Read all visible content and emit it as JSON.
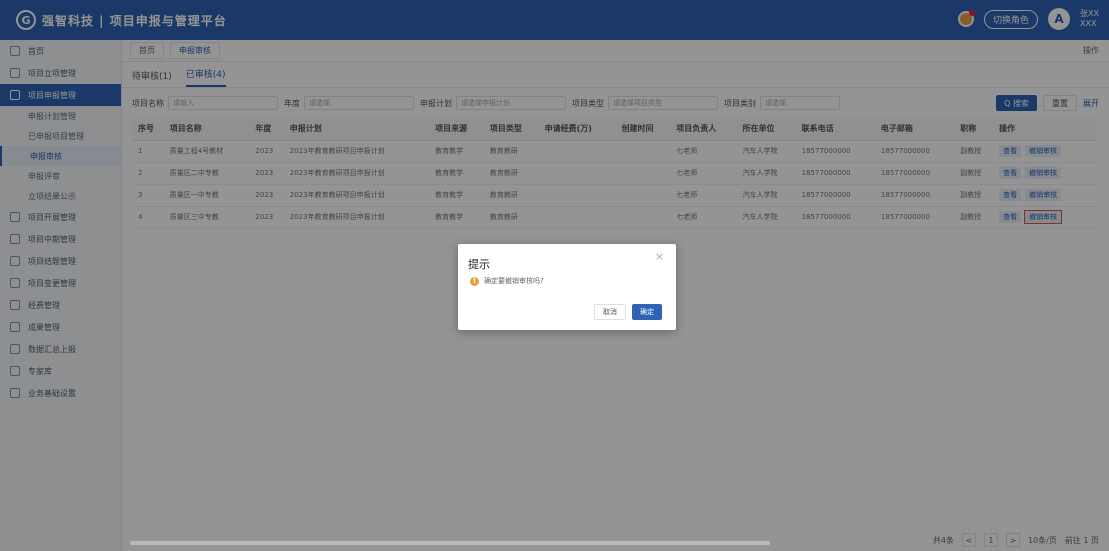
{
  "header": {
    "logo": "G",
    "title": "强智科技 | 项目申报与管理平台",
    "switch_role": "切换角色",
    "user_name": "张XX",
    "user_role": "XXX",
    "avatar": "A"
  },
  "sidebar": {
    "items": [
      {
        "label": "首页"
      },
      {
        "label": "项目立项管理"
      },
      {
        "label": "项目申报管理",
        "active": true
      },
      {
        "label": "项目开展管理"
      },
      {
        "label": "项目中期管理"
      },
      {
        "label": "项目结题管理"
      },
      {
        "label": "项目变更管理"
      },
      {
        "label": "经费管理"
      },
      {
        "label": "成果管理"
      },
      {
        "label": "数据汇总上报"
      },
      {
        "label": "专家库"
      },
      {
        "label": "业务基础设置"
      }
    ],
    "sub_items": [
      {
        "label": "申报计划管理"
      },
      {
        "label": "已申报项目管理"
      },
      {
        "label": "申报审核",
        "current": true
      },
      {
        "label": "申报评审"
      },
      {
        "label": "立项结果公示"
      }
    ]
  },
  "tagbar": {
    "tags": [
      {
        "label": "首页"
      },
      {
        "label": "申报审核"
      }
    ],
    "ops": "操作"
  },
  "subtabs": [
    {
      "label": "待审核(1)"
    },
    {
      "label": "已审核(4)",
      "on": true
    }
  ],
  "filters": {
    "project_name_label": "项目名称",
    "project_name_placeholder": "请输入",
    "year_label": "年度",
    "year_placeholder": "请选择",
    "plan_label": "申报计划",
    "plan_placeholder": "请选择申报计划",
    "type_label": "项目类型",
    "type_placeholder": "请选择项目类型",
    "category_label": "项目类别",
    "category_placeholder": "请选择",
    "search": "Q 搜索",
    "reset": "重置",
    "expand": "展开"
  },
  "table": {
    "columns": [
      "序号",
      "项目名称",
      "年度",
      "申报计划",
      "项目来源",
      "项目类型",
      "申请经费(万)",
      "创建时间",
      "项目负责人",
      "所在单位",
      "联系电话",
      "电子邮箱",
      "职称",
      "操作"
    ],
    "rows": [
      {
        "no": "1",
        "name": "质量工程4号教材",
        "year": "2023",
        "plan": "2023年教育教研项目申报计划",
        "source": "教育教学",
        "type": "教育教研",
        "fund": "",
        "created": "",
        "leader": "七老师",
        "unit": "汽车人学院",
        "phone": "18577000000",
        "email": "18577000000",
        "title": "副教授",
        "op1": "查看",
        "op2": "撤销审核"
      },
      {
        "no": "2",
        "name": "质量区二中专教",
        "year": "2023",
        "plan": "2023年教育教研项目申报计划",
        "source": "教育教学",
        "type": "教育教研",
        "fund": "",
        "created": "",
        "leader": "七老师",
        "unit": "汽车人学院",
        "phone": "18577000000",
        "email": "18577000000",
        "title": "副教授",
        "op1": "查看",
        "op2": "撤销审核"
      },
      {
        "no": "3",
        "name": "质量区一中专教",
        "year": "2023",
        "plan": "2023年教育教研项目申报计划",
        "source": "教育教学",
        "type": "教育教研",
        "fund": "",
        "created": "",
        "leader": "七老师",
        "unit": "汽车人学院",
        "phone": "18577000000",
        "email": "18577000000",
        "title": "副教授",
        "op1": "查看",
        "op2": "撤销审核"
      },
      {
        "no": "4",
        "name": "质量区三中专教",
        "year": "2023",
        "plan": "2023年教育教研项目申报计划",
        "source": "教育教学",
        "type": "教育教研",
        "fund": "",
        "created": "",
        "leader": "七老师",
        "unit": "汽车人学院",
        "phone": "18577000000",
        "email": "18577000000",
        "title": "副教授",
        "op1": "查看",
        "op2": "撤销审核"
      }
    ]
  },
  "pager": {
    "total": "共4条",
    "prev": "<",
    "page": "1",
    "next": ">",
    "size": "10条/页",
    "goto": "前往 1 页"
  },
  "dialog": {
    "title": "提示",
    "close": "×",
    "warn_glyph": "!",
    "message": "确定要撤销审核吗?",
    "cancel": "取消",
    "ok": "确定"
  }
}
